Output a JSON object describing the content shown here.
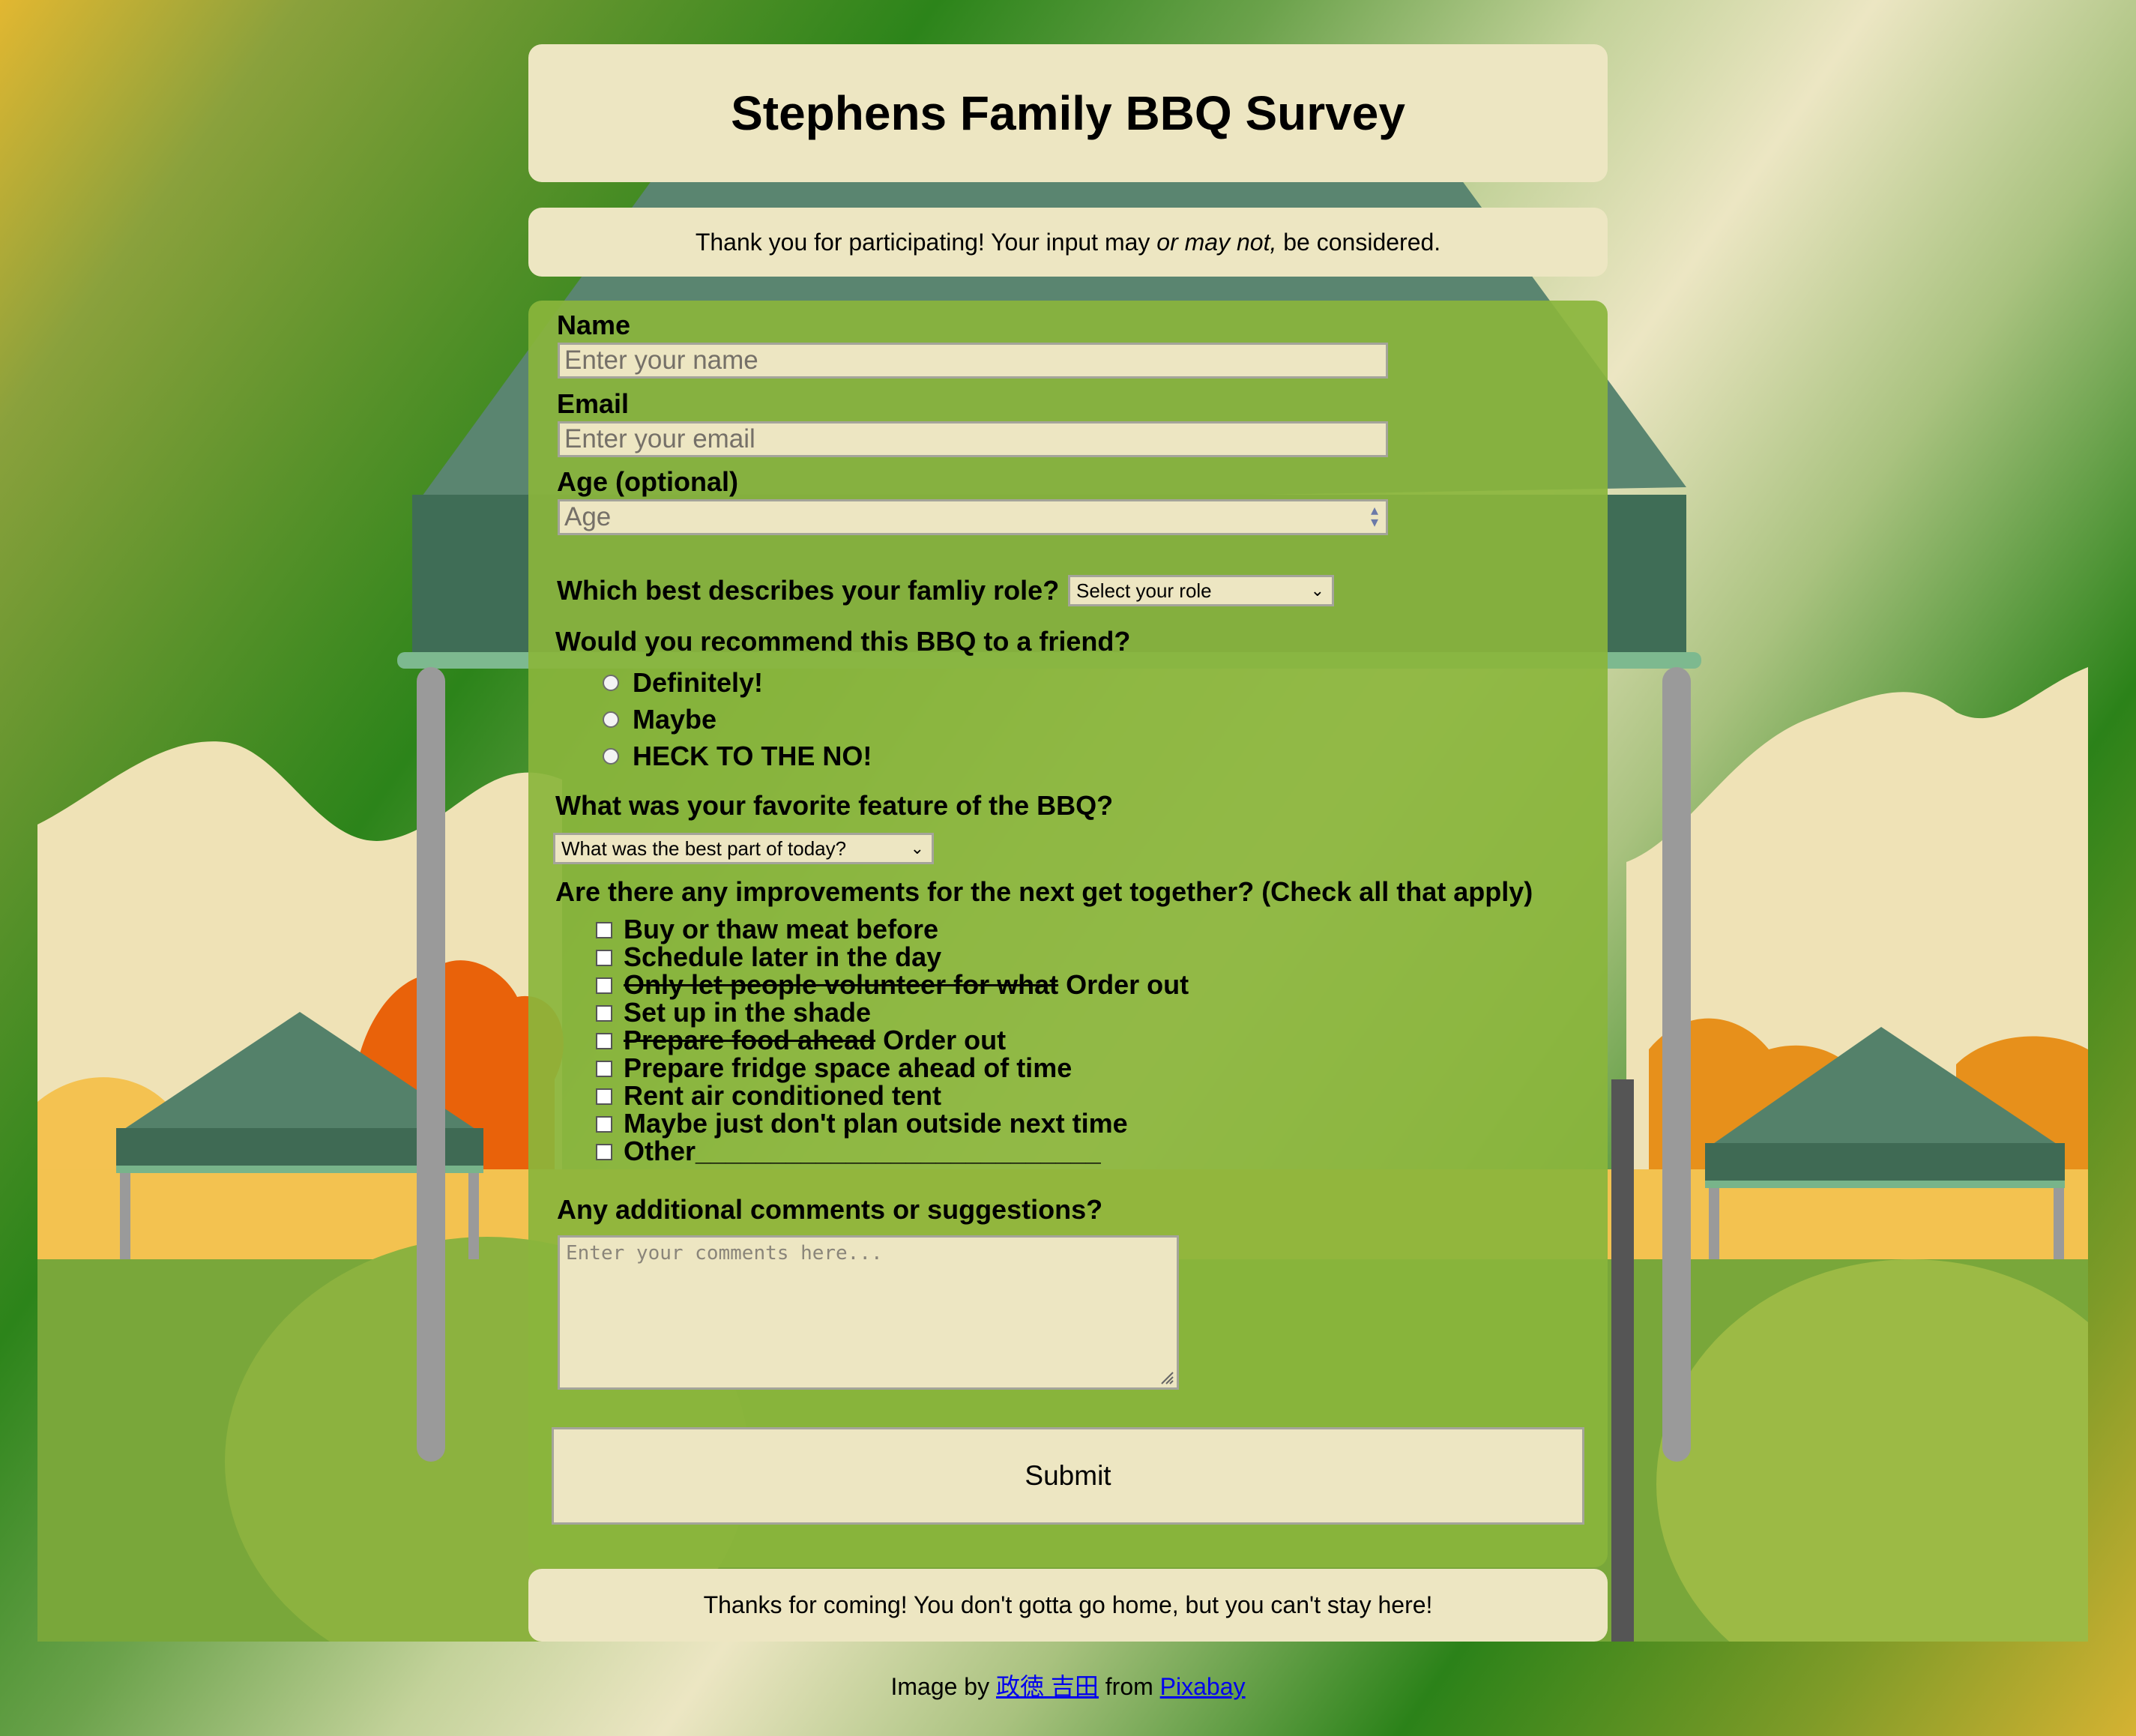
{
  "header": {
    "title": "Stephens Family BBQ Survey"
  },
  "intro": {
    "before": "Thank you for participating! Your input may ",
    "emphasis": "or may not,",
    "after": " be considered."
  },
  "form": {
    "name": {
      "label": "Name",
      "placeholder": "Enter your name"
    },
    "email": {
      "label": "Email",
      "placeholder": "Enter your email"
    },
    "age": {
      "label": "Age (optional)",
      "placeholder": "Age"
    },
    "role": {
      "label": "Which best describes your famliy role?",
      "selected": "Select your role"
    },
    "recommend": {
      "label": "Would you recommend this BBQ to a friend?",
      "options": [
        "Definitely!",
        "Maybe",
        "HECK TO THE NO!"
      ]
    },
    "favorite": {
      "label": "What was your favorite feature of the BBQ?",
      "selected": "What was the best part of today?"
    },
    "improvements": {
      "label": "Are there any improvements for the next get together? (Check all that apply)",
      "items": [
        {
          "struck": "",
          "text": "Buy or thaw meat before"
        },
        {
          "struck": "",
          "text": "Schedule later in the day"
        },
        {
          "struck": "Only let people volunteer for what",
          "text": " Order out"
        },
        {
          "struck": "",
          "text": "Set up in the shade"
        },
        {
          "struck": "Prepare food ahead",
          "text": " Order out"
        },
        {
          "struck": "",
          "text": "Prepare fridge space ahead of time"
        },
        {
          "struck": "",
          "text": "Rent air conditioned tent"
        },
        {
          "struck": "",
          "text": "Maybe just don't plan outside next time"
        },
        {
          "struck": "",
          "text": "Other___________________________"
        }
      ]
    },
    "comments": {
      "label": "Any additional comments or suggestions?",
      "placeholder": "Enter your comments here..."
    },
    "submit_label": "Submit"
  },
  "outro": {
    "text": "Thanks for coming! You don't gotta go home, but you can't stay here!"
  },
  "credit": {
    "prefix": "Image by ",
    "author": "政徳 吉田",
    "middle": " from ",
    "site": "Pixabay"
  },
  "colors": {
    "panel": "#ede6c2",
    "form_bg": "#8ab53c",
    "grass": "#9cb93d",
    "tent_green": "#54816a",
    "foliage_orange": "#e9620a"
  }
}
